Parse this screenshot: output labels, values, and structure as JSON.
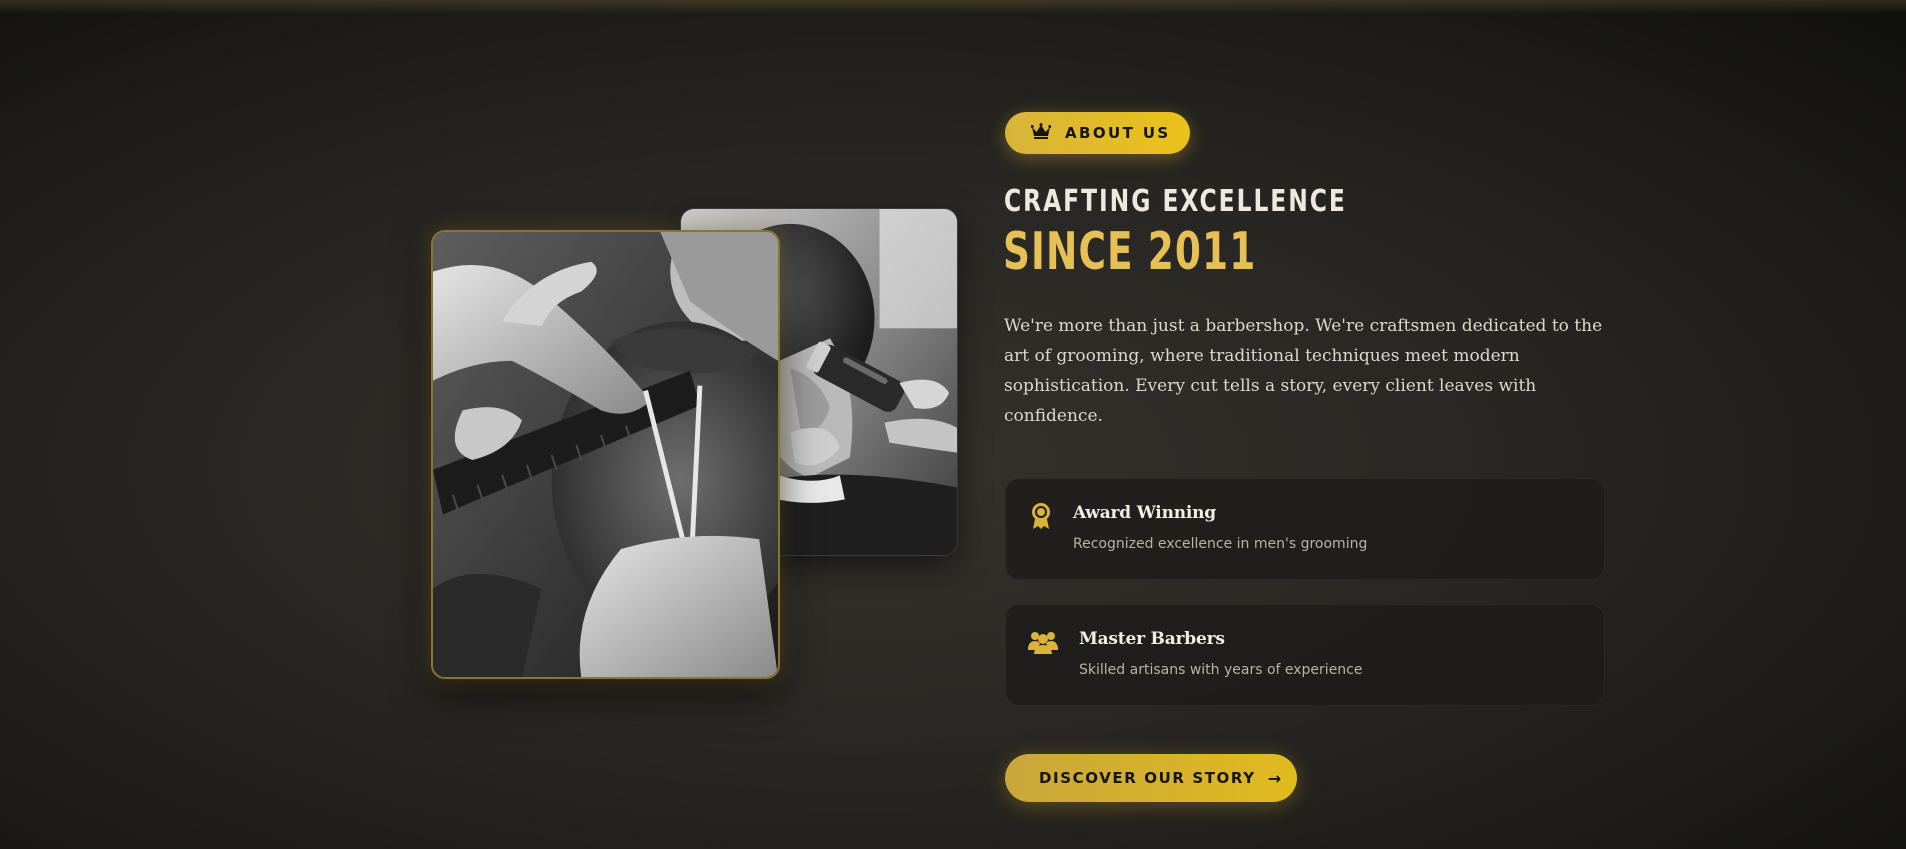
{
  "about": {
    "badge_label": "ABOUT US",
    "badge_icon": "crown-icon",
    "heading_line1": "CRAFTING EXCELLENCE",
    "heading_line2": "SINCE 2011",
    "intro": "We're more than just a barbershop. We're craftsmen dedicated to the art of grooming, where traditional techniques meet modern sophistication. Every cut tells a story, every client leaves with confidence."
  },
  "features": [
    {
      "icon": "award-ribbon-icon",
      "title": "Award Winning",
      "description": "Recognized excellence in men's grooming"
    },
    {
      "icon": "users-group-icon",
      "title": "Master Barbers",
      "description": "Skilled artisans with years of experience"
    }
  ],
  "cta": {
    "label": "DISCOVER OUR STORY",
    "icon": "arrow-right-icon"
  },
  "colors": {
    "accent_gold": "#e6bf55",
    "button_gold": "#ebc21a",
    "background": "#2a2824"
  }
}
